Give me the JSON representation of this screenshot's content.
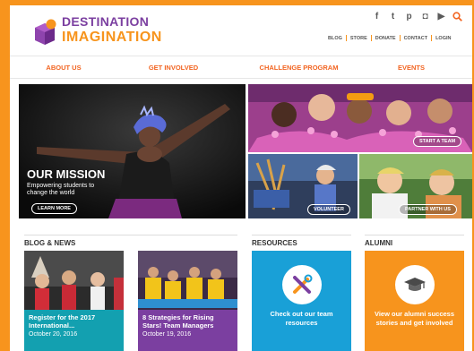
{
  "brand": {
    "line1": "DESTINATION",
    "line2": "IMAGINATION"
  },
  "social": [
    {
      "icon": "facebook-icon",
      "glyph": "f"
    },
    {
      "icon": "twitter-icon",
      "glyph": "t"
    },
    {
      "icon": "pinterest-icon",
      "glyph": "p"
    },
    {
      "icon": "instagram-icon",
      "glyph": "◘"
    },
    {
      "icon": "youtube-icon",
      "glyph": "▶"
    }
  ],
  "utility_links": [
    "BLOG",
    "STORE",
    "DONATE",
    "CONTACT",
    "LOGIN"
  ],
  "nav": [
    "ABOUT US",
    "GET INVOLVED",
    "CHALLENGE PROGRAM",
    "EVENTS"
  ],
  "hero": {
    "title": "OUR MISSION",
    "subtitle": "Empowering students to change the world",
    "button": "LEARN MORE"
  },
  "tiles": {
    "start": "START A TEAM",
    "volunteer": "VOLUNTEER",
    "partner": "PARTNER WITH US"
  },
  "sections": {
    "blog": "BLOG & NEWS",
    "resources": "RESOURCES",
    "alumni": "ALUMNI"
  },
  "blog": [
    {
      "title": "Register for the 2017 International...",
      "date": "October 20, 2016"
    },
    {
      "title": "8 Strategies for Rising Stars! Team Managers",
      "date": "October 19, 2016"
    }
  ],
  "resources": {
    "text": "Check out our team resources"
  },
  "alumni": {
    "text": "View our alumni success stories and get involved"
  },
  "colors": {
    "orange": "#f7941d",
    "purple": "#7b3fa0",
    "teal": "#19a0d7",
    "nav_text": "#f26522"
  }
}
